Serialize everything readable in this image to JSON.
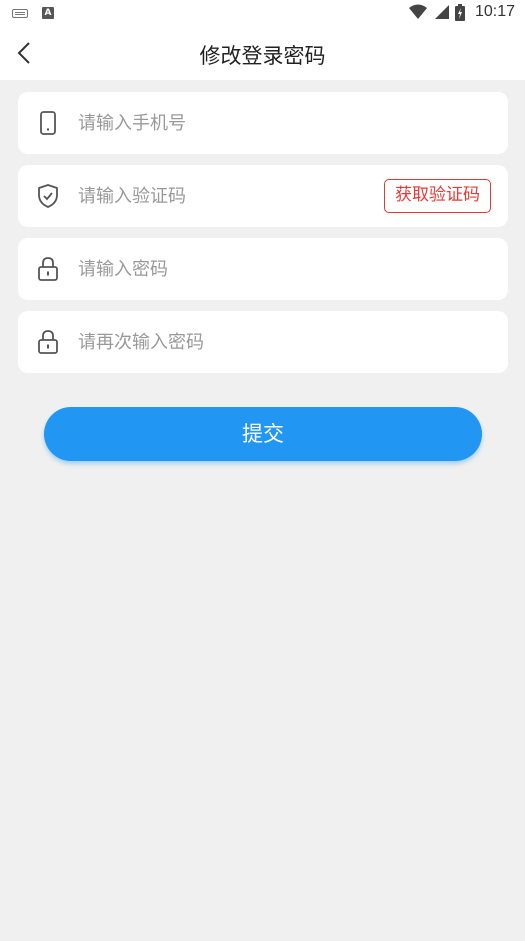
{
  "status_bar": {
    "a_badge": "A",
    "time": "10:17"
  },
  "header": {
    "title": "修改登录密码"
  },
  "form": {
    "phone": {
      "placeholder": "请输入手机号",
      "value": ""
    },
    "code": {
      "placeholder": "请输入验证码",
      "value": "",
      "button_label": "获取验证码"
    },
    "password": {
      "placeholder": "请输入密码",
      "value": ""
    },
    "confirm_password": {
      "placeholder": "请再次输入密码",
      "value": ""
    }
  },
  "submit": {
    "label": "提交"
  },
  "colors": {
    "accent": "#2196f3",
    "code_button": "#e53935",
    "background": "#f0f0f0"
  },
  "icons": [
    "keyboard-icon",
    "a-icon",
    "wifi-icon",
    "signal-icon",
    "battery-icon",
    "back-icon",
    "phone-icon",
    "shield-check-icon",
    "lock-icon"
  ]
}
